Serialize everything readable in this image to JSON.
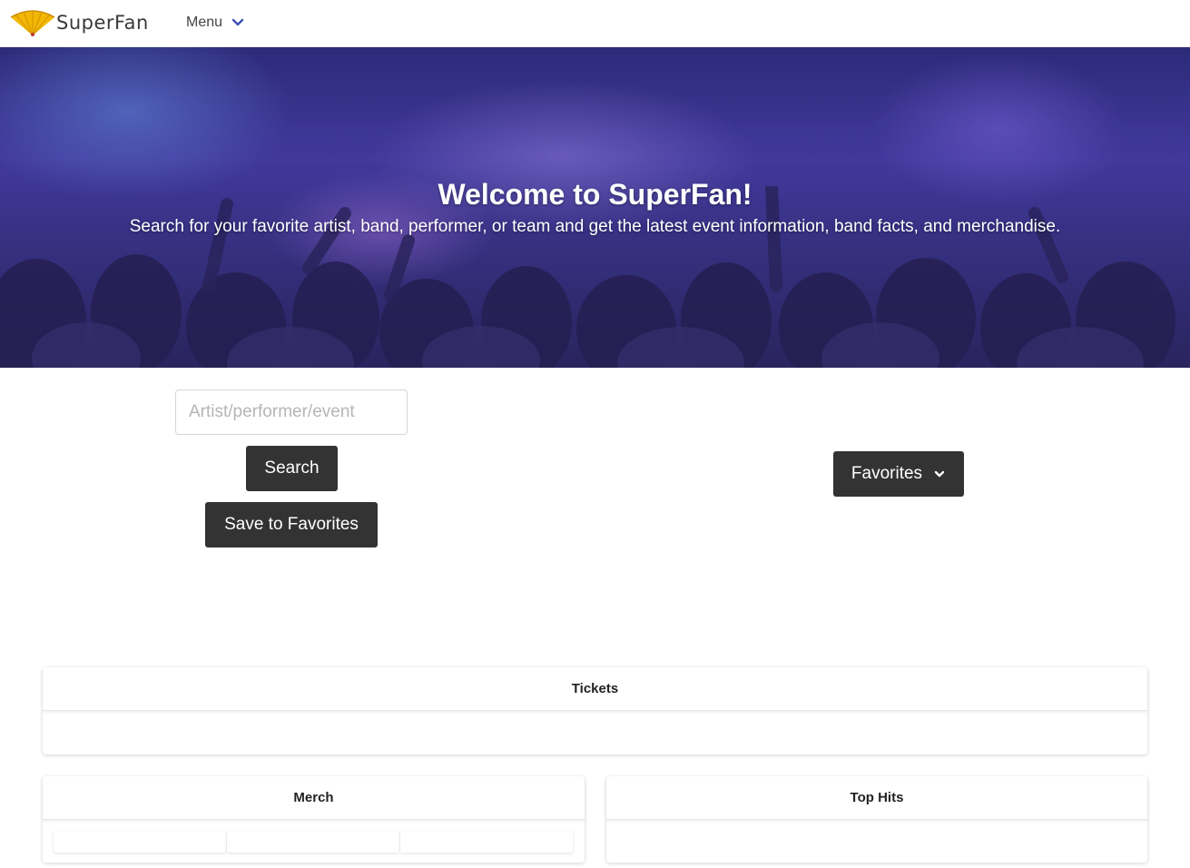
{
  "brand": {
    "name": "SuperFan",
    "accent": "#f2b705"
  },
  "nav": {
    "menu_label": "Menu",
    "chevron_color": "#3f51b5"
  },
  "hero": {
    "title": "Welcome to SuperFan!",
    "subtitle": "Search for your favorite artist, band, performer, or team and get the latest event information, band facts, and merchandise."
  },
  "search": {
    "placeholder": "Artist/performer/event",
    "value": "",
    "search_button": "Search",
    "save_button": "Save to Favorites"
  },
  "favorites": {
    "label": "Favorites"
  },
  "sections": {
    "tickets": {
      "title": "Tickets"
    },
    "merch": {
      "title": "Merch"
    },
    "top_hits": {
      "title": "Top Hits"
    }
  },
  "colors": {
    "button_bg": "#333333",
    "hero_tint": "#3c3486"
  }
}
